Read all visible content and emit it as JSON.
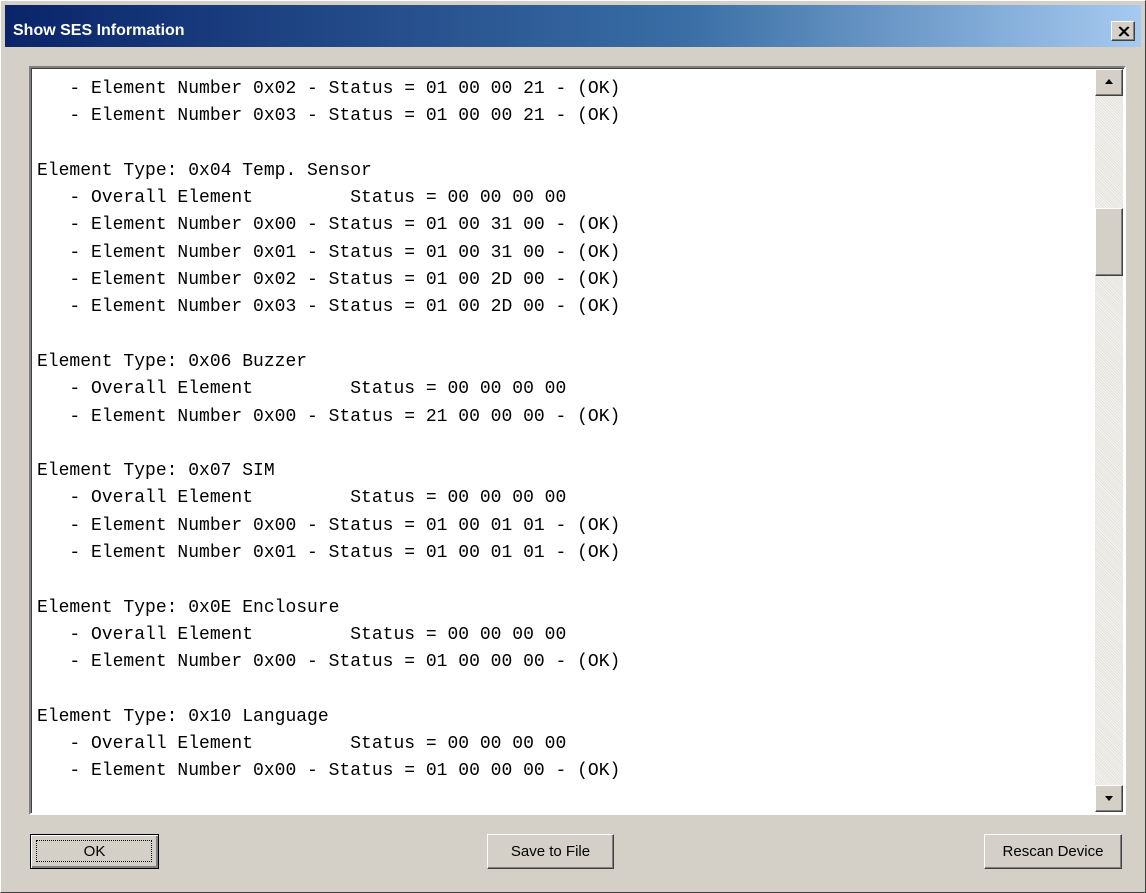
{
  "window": {
    "title": "Show SES Information",
    "titlebar_color": "#0a246a",
    "background_color": "#d4d0c8",
    "close_icon": "close-icon"
  },
  "content": {
    "lines": [
      "   - Element Number 0x02 - Status = 01 00 00 21 - (OK)",
      "   - Element Number 0x03 - Status = 01 00 00 21 - (OK)",
      "",
      "Element Type: 0x04 Temp. Sensor",
      "   - Overall Element         Status = 00 00 00 00",
      "   - Element Number 0x00 - Status = 01 00 31 00 - (OK)",
      "   - Element Number 0x01 - Status = 01 00 31 00 - (OK)",
      "   - Element Number 0x02 - Status = 01 00 2D 00 - (OK)",
      "   - Element Number 0x03 - Status = 01 00 2D 00 - (OK)",
      "",
      "Element Type: 0x06 Buzzer",
      "   - Overall Element         Status = 00 00 00 00",
      "   - Element Number 0x00 - Status = 21 00 00 00 - (OK)",
      "",
      "Element Type: 0x07 SIM",
      "   - Overall Element         Status = 00 00 00 00",
      "   - Element Number 0x00 - Status = 01 00 01 01 - (OK)",
      "   - Element Number 0x01 - Status = 01 00 01 01 - (OK)",
      "",
      "Element Type: 0x0E Enclosure",
      "   - Overall Element         Status = 00 00 00 00",
      "   - Element Number 0x00 - Status = 01 00 00 00 - (OK)",
      "",
      "Element Type: 0x10 Language",
      "   - Overall Element         Status = 00 00 00 00",
      "   - Element Number 0x00 - Status = 01 00 00 00 - (OK)"
    ],
    "scroll_position": 0.18
  },
  "buttons": {
    "ok_label": "OK",
    "save_label": "Save to File",
    "rescan_label": "Rescan Device"
  }
}
